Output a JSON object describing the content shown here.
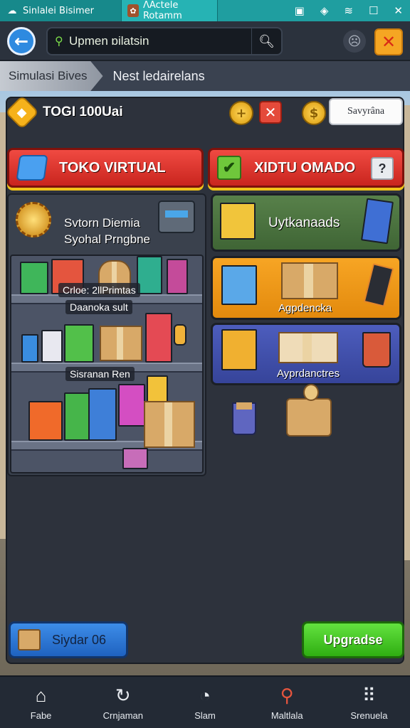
{
  "window": {
    "tab1_title": "Sinlalei Bisimer",
    "tab2_title": "ɅActele Rotamm",
    "status_icons": [
      "sim-icon",
      "location-icon",
      "wifi-icon",
      "maximize-icon",
      "close-icon"
    ]
  },
  "header": {
    "search_value": "Upmen ɒilatsin",
    "search_placeholder": ""
  },
  "breadcrumb": {
    "item1": "Simulasi Bives",
    "item2": "Nest ledairelans"
  },
  "currency": {
    "label": "TOGI 100Uai",
    "save_label": "Savyrâna"
  },
  "titles": {
    "left": "TOKO VIRTUAL",
    "right": "XIDTU OMADO",
    "help": "?"
  },
  "left_card": {
    "line1": "Svtorn Diemia",
    "line2": "Syohal Prngbne",
    "shelf_label1": "Crloe: 2llPrimtas",
    "shelf_label2": "Daanoka sult",
    "shelf_label3": "Sisranan Ren"
  },
  "right_cards": [
    {
      "label": "Uytkanaads",
      "color": "#4f7842"
    },
    {
      "label": "Agpdencka",
      "color": "#f39a1a"
    },
    {
      "label": "Ayprdanctres",
      "color": "#4454ab"
    }
  ],
  "actions": {
    "stats_label": "Siydar 06",
    "upgrade_label": "Upgradse"
  },
  "nav": [
    {
      "label": "Fabe",
      "icon": "home-icon"
    },
    {
      "label": "Crnjaman",
      "icon": "refresh-icon"
    },
    {
      "label": "Slam",
      "icon": "gauge-icon"
    },
    {
      "label": "Maltlala",
      "icon": "search-chat-icon"
    },
    {
      "label": "Srenuela",
      "icon": "grid-icon"
    }
  ]
}
